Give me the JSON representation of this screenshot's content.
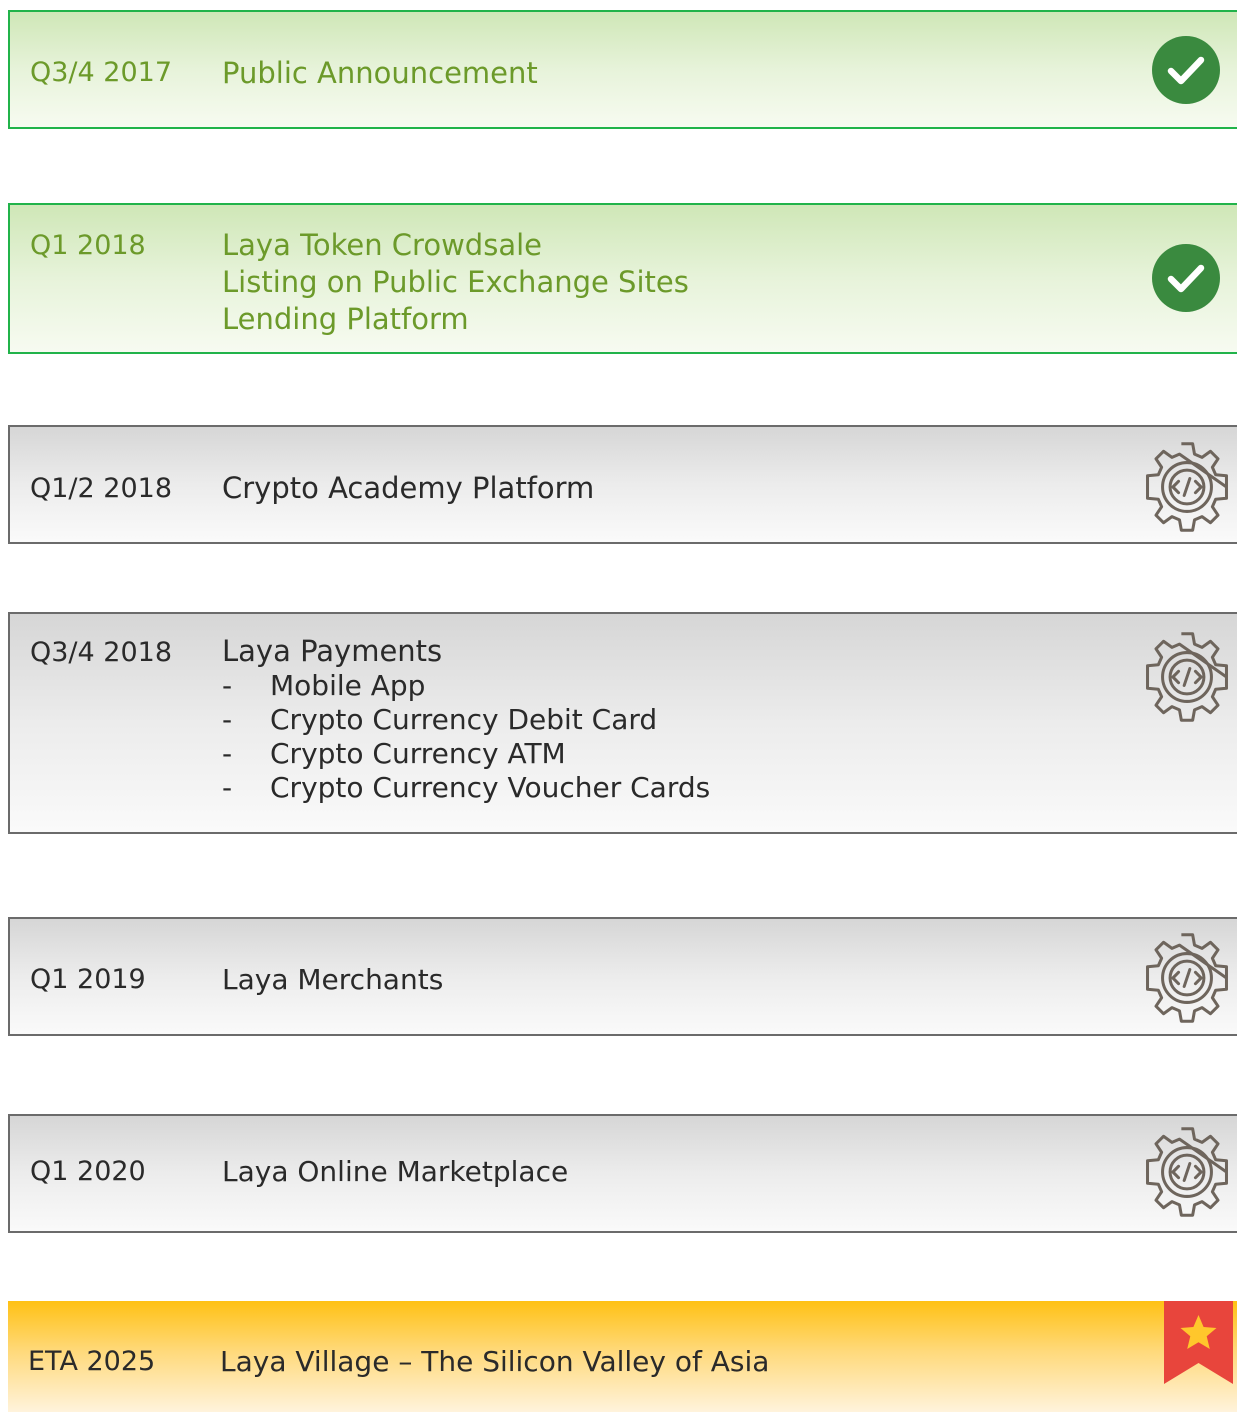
{
  "milestones": [
    {
      "status": "done",
      "date": "Q3/4 2017",
      "items": [
        "Public Announcement"
      ]
    },
    {
      "status": "done",
      "date": "Q1 2018",
      "items": [
        "Laya Token Crowdsale",
        "Listing on Public Exchange Sites",
        "Lending Platform"
      ]
    },
    {
      "status": "in-development",
      "date": "Q1/2 2018",
      "items": [
        "Crypto Academy Platform"
      ]
    },
    {
      "status": "in-development",
      "date": "Q3/4 2018",
      "items": [
        "Laya Payments"
      ],
      "subitems": [
        {
          "bullet": "-",
          "text": "Mobile App"
        },
        {
          "bullet": "-",
          "text": "Crypto Currency Debit Card"
        },
        {
          "bullet": "-",
          "text": "Crypto Currency ATM"
        },
        {
          "bullet": "-",
          "text": "Crypto Currency Voucher Cards"
        }
      ]
    },
    {
      "status": "in-development",
      "date": "Q1 2019",
      "items": [
        "Laya Merchants"
      ]
    },
    {
      "status": "in-development",
      "date": "Q1 2020",
      "items": [
        "Laya Online Marketplace"
      ]
    },
    {
      "status": "goal",
      "date": "ETA 2025",
      "items": [
        "Laya Village – The Silicon Valley of Asia"
      ]
    }
  ],
  "icons": {
    "done": "check-circle-icon",
    "in-development": "gear-code-icon",
    "goal": "star-ribbon-icon"
  },
  "colors": {
    "done_border": "#21b34a",
    "done_text": "#6c9a2a",
    "done_icon": "#3a8a3f",
    "dev_border": "#6b6b6b",
    "dev_icon": "#6e655c",
    "goal_fill": "#ffc114",
    "ribbon": "#e8453c",
    "star": "#ffc72c"
  }
}
